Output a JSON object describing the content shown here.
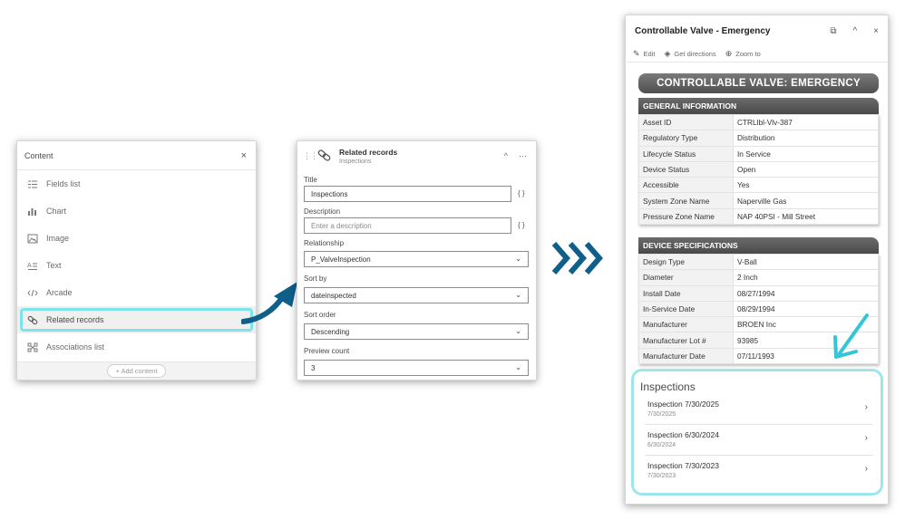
{
  "content_panel": {
    "title": "Content",
    "close": "×",
    "items": [
      {
        "label": "Fields list",
        "icon": "fields-list-icon"
      },
      {
        "label": "Chart",
        "icon": "chart-icon"
      },
      {
        "label": "Image",
        "icon": "image-icon"
      },
      {
        "label": "Text",
        "icon": "text-icon"
      },
      {
        "label": "Arcade",
        "icon": "arcade-icon"
      },
      {
        "label": "Related records",
        "icon": "related-records-icon"
      },
      {
        "label": "Associations list",
        "icon": "associations-icon"
      }
    ],
    "add_content": "+ Add content"
  },
  "config_panel": {
    "title": "Related records",
    "subtitle": "Inspections",
    "collapse": "^",
    "more": "···",
    "title_label": "Title",
    "title_value": "Inspections",
    "description_label": "Description",
    "description_placeholder": "Enter a description",
    "relationship_label": "Relationship",
    "relationship_value": "P_ValveInspection",
    "sort_by_label": "Sort by",
    "sort_by_value": "dateinspected",
    "sort_order_label": "Sort order",
    "sort_order_value": "Descending",
    "preview_count_label": "Preview count",
    "preview_count_value": "3",
    "expr_icon": "{ }"
  },
  "popup": {
    "title": "Controllable Valve - Emergency",
    "actions": {
      "edit": "Edit",
      "directions": "Get directions",
      "zoom": "Zoom to"
    },
    "banner": "CONTROLLABLE VALVE: EMERGENCY",
    "general": {
      "header": "GENERAL INFORMATION",
      "rows": [
        {
          "k": "Asset ID",
          "v": "CTRLlbl-Vlv-387"
        },
        {
          "k": "Regulatory Type",
          "v": "Distribution"
        },
        {
          "k": "Lifecycle Status",
          "v": "In Service"
        },
        {
          "k": "Device Status",
          "v": "Open"
        },
        {
          "k": "Accessible",
          "v": "Yes"
        },
        {
          "k": "System Zone Name",
          "v": "Naperville Gas"
        },
        {
          "k": "Pressure Zone Name",
          "v": "NAP 40PSI - Mill Street"
        }
      ]
    },
    "specs": {
      "header": "DEVICE SPECIFICATIONS",
      "rows": [
        {
          "k": "Design Type",
          "v": "V-Ball"
        },
        {
          "k": "Diameter",
          "v": "2 Inch"
        },
        {
          "k": "Install Date",
          "v": "08/27/1994"
        },
        {
          "k": "In-Service Date",
          "v": "08/29/1994"
        },
        {
          "k": "Manufacturer",
          "v": "BROEN Inc"
        },
        {
          "k": "Manufacturer Lot #",
          "v": "93985"
        },
        {
          "k": "Manufacturer Date",
          "v": "07/11/1993"
        }
      ]
    },
    "inspections": {
      "title": "Inspections",
      "items": [
        {
          "title": "Inspection 7/30/2025",
          "date": "7/30/2025"
        },
        {
          "title": "Inspection 6/30/2024",
          "date": "6/30/2024"
        },
        {
          "title": "Inspection 7/30/2023",
          "date": "7/30/2023"
        }
      ]
    }
  },
  "colors": {
    "highlight": "#7ee3ea",
    "arrow": "#0f5f8a",
    "header_gray": "#555555"
  }
}
